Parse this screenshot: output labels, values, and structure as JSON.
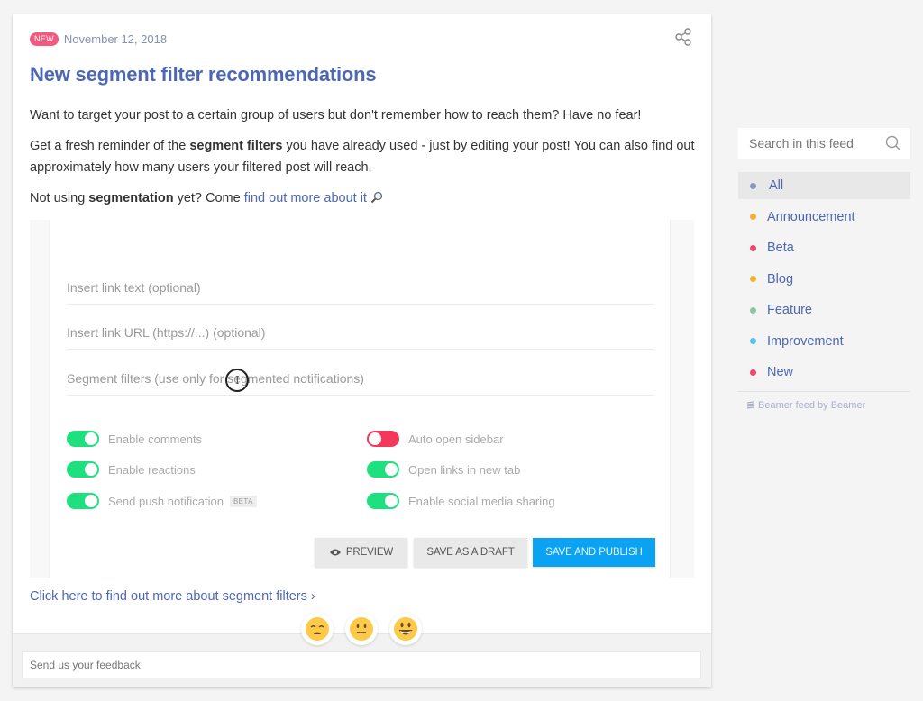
{
  "post": {
    "badge": "NEW",
    "date": "November 12, 2018",
    "title": "New segment filter recommendations",
    "paragraph1": "Want to target your post to a certain group of users but don't remember how to reach them? Have no fear!",
    "paragraph2_pre": "Get a fresh reminder of the ",
    "paragraph2_bold": "segment filters",
    "paragraph2_post": " you have already used - just by editing your post! You can also find out approximately how many users your filtered post will reach.",
    "paragraph3_pre": "Not using ",
    "paragraph3_bold": "segmentation",
    "paragraph3_mid": " yet? Come ",
    "paragraph3_link": "find out more about it",
    "more_link": "Click here to find out more about segment filters",
    "more_link_chevron": "›"
  },
  "embed": {
    "fields": [
      {
        "placeholder": "Insert link text (optional)"
      },
      {
        "placeholder": "Insert link URL (https://...) (optional)"
      },
      {
        "placeholder": "Segment filters (use only for segmented notifications)"
      }
    ],
    "toggles_left": [
      {
        "label": "Enable comments",
        "state": "on"
      },
      {
        "label": "Enable reactions",
        "state": "on"
      },
      {
        "label": "Send push notification",
        "state": "on",
        "tag": "BETA"
      }
    ],
    "toggles_right": [
      {
        "label": "Auto open sidebar",
        "state": "off"
      },
      {
        "label": "Open links in new tab",
        "state": "on"
      },
      {
        "label": "Enable social media sharing",
        "state": "on"
      }
    ],
    "buttons": {
      "preview": "PREVIEW",
      "draft": "SAVE AS A DRAFT",
      "publish": "SAVE AND PUBLISH"
    },
    "colors": {
      "toggle_on": "#1ee07f",
      "toggle_off": "#f2395b",
      "publish": "#0aa2f2"
    }
  },
  "reactions": [
    {
      "name": "sad"
    },
    {
      "name": "neutral"
    },
    {
      "name": "happy"
    }
  ],
  "feedback": {
    "placeholder": "Send us your feedback"
  },
  "sidebar": {
    "search_placeholder": "Search in this feed",
    "categories": [
      {
        "label": "All",
        "color": "#8c96c0",
        "active": true
      },
      {
        "label": "Announcement",
        "color": "#f3b32c"
      },
      {
        "label": "Beta",
        "color": "#f2466f"
      },
      {
        "label": "Blog",
        "color": "#f3b32c"
      },
      {
        "label": "Feature",
        "color": "#8cc4a8"
      },
      {
        "label": "Improvement",
        "color": "#4fc2f0"
      },
      {
        "label": "New",
        "color": "#f2466f"
      }
    ],
    "powered_by": "Beamer feed by Beamer"
  }
}
